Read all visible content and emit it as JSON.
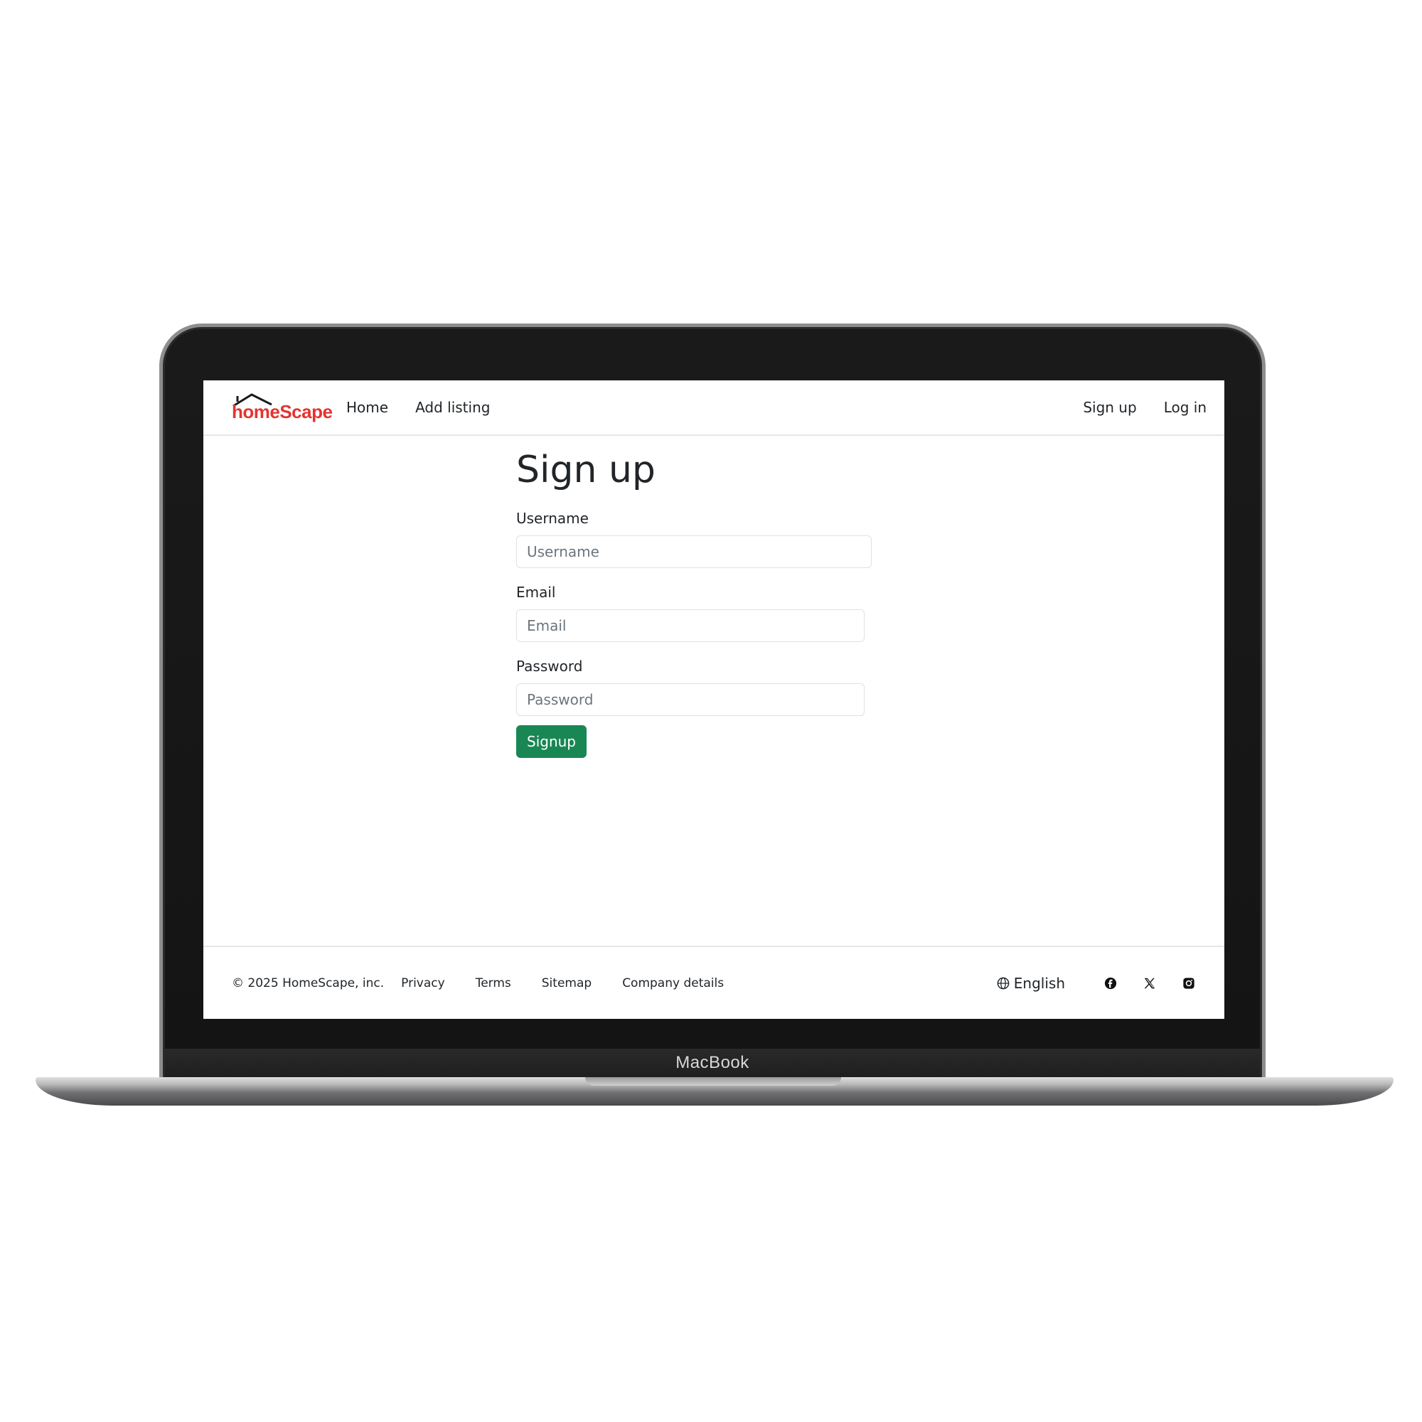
{
  "device": {
    "label": "MacBook"
  },
  "navbar": {
    "logo_text": "homeScape",
    "links": [
      "Home",
      "Add listing"
    ],
    "right_links": [
      "Sign up",
      "Log in"
    ]
  },
  "form": {
    "title": "Sign up",
    "username_label": "Username",
    "username_placeholder": "Username",
    "email_label": "Email",
    "email_placeholder": "Email",
    "password_label": "Password",
    "password_placeholder": "Password",
    "submit_label": "Signup"
  },
  "footer": {
    "copyright": "© 2025 HomeScape, inc.",
    "links": [
      "Privacy",
      "Terms",
      "Sitemap",
      "Company details"
    ],
    "language": "English",
    "social_icons": [
      "facebook-icon",
      "x-icon",
      "instagram-icon"
    ]
  },
  "colors": {
    "brand": "#e3342f",
    "primary_button": "#198754"
  }
}
